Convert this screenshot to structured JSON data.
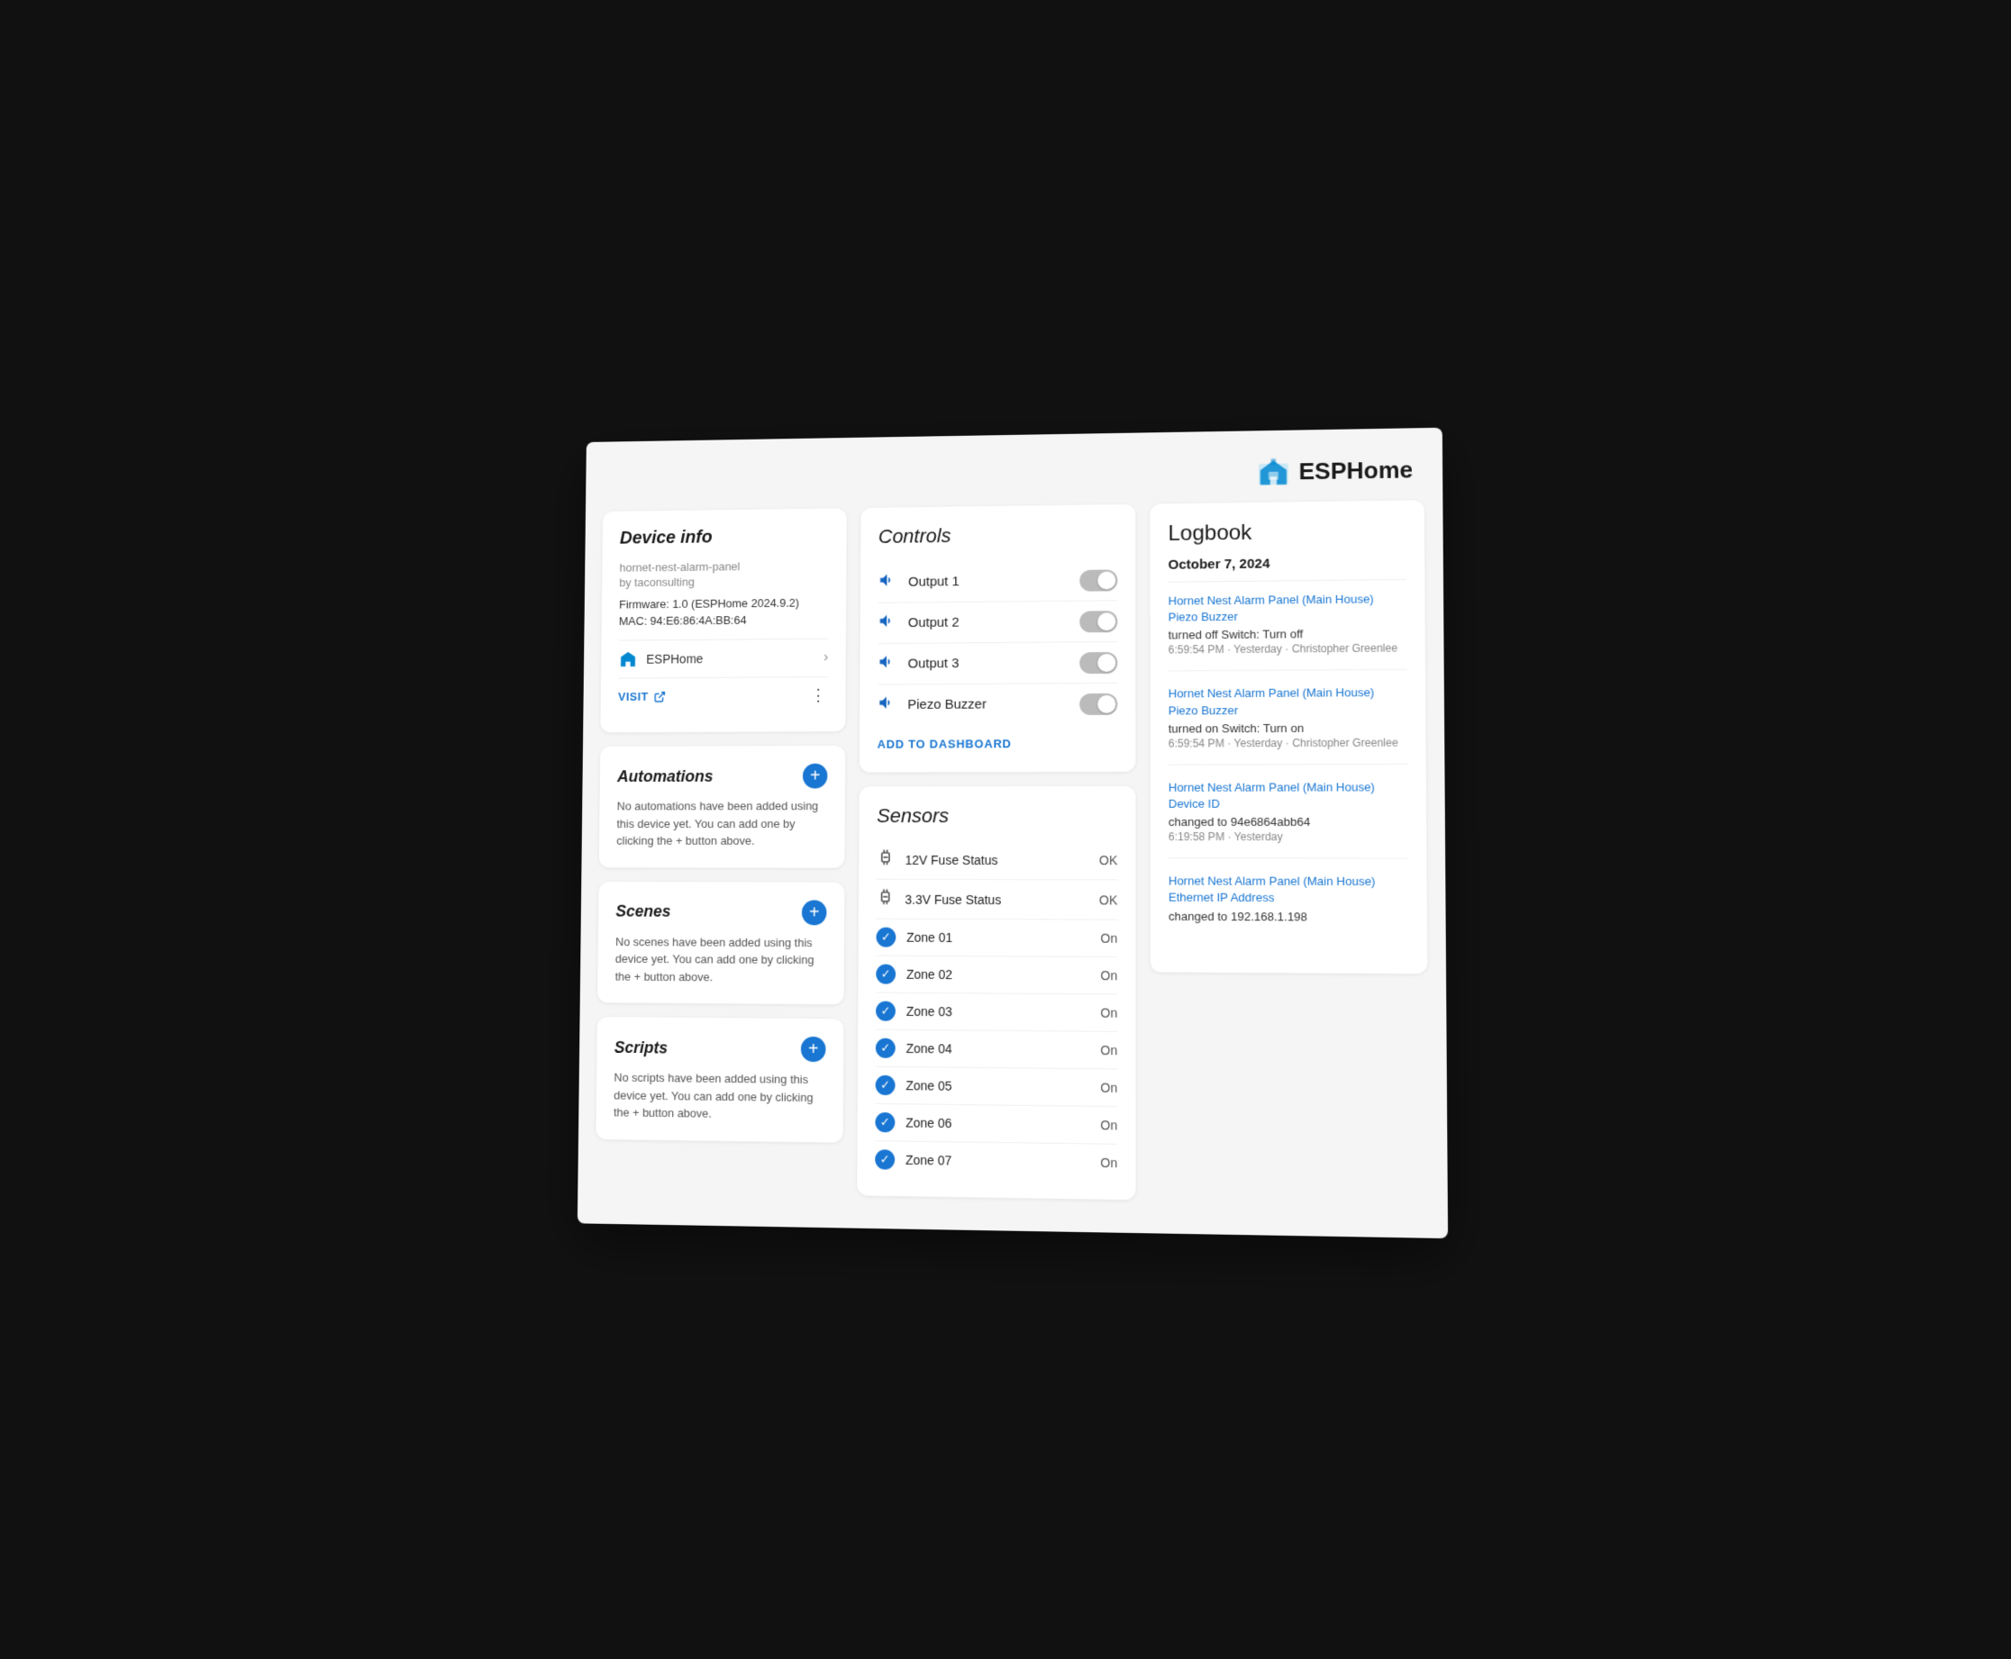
{
  "header": {
    "logo_text": "ESPHome"
  },
  "device_info": {
    "title": "Device info",
    "name": "hornet-nest-alarm-panel",
    "by": "by taconsulting",
    "firmware": "Firmware: 1.0 (ESPHome 2024.9.2)",
    "mac": "MAC: 94:E6:86:4A:BB:64",
    "esphome_link": "ESPHome",
    "visit_label": "VISIT",
    "chevron": "›",
    "more": "⋮"
  },
  "automations": {
    "title": "Automations",
    "empty_text": "No automations have been added using this device yet. You can add one by clicking the + button above.",
    "add_label": "+"
  },
  "scenes": {
    "title": "Scenes",
    "empty_text": "No scenes have been added using this device yet. You can add one by clicking the + button above.",
    "add_label": "+"
  },
  "scripts": {
    "title": "Scripts",
    "empty_text": "No scripts have been added using this device yet. You can add one by clicking the + button above.",
    "add_label": "+"
  },
  "controls": {
    "title": "Controls",
    "outputs": [
      {
        "label": "Output 1"
      },
      {
        "label": "Output 2"
      },
      {
        "label": "Output 3"
      },
      {
        "label": "Piezo Buzzer"
      }
    ],
    "add_to_dashboard": "ADD TO DASHBOARD"
  },
  "sensors": {
    "title": "Sensors",
    "items": [
      {
        "label": "12V Fuse Status",
        "value": "OK",
        "type": "fuse"
      },
      {
        "label": "3.3V Fuse Status",
        "value": "OK",
        "type": "fuse"
      },
      {
        "label": "Zone 01",
        "value": "On",
        "type": "check"
      },
      {
        "label": "Zone 02",
        "value": "On",
        "type": "check"
      },
      {
        "label": "Zone 03",
        "value": "On",
        "type": "check"
      },
      {
        "label": "Zone 04",
        "value": "On",
        "type": "check"
      },
      {
        "label": "Zone 05",
        "value": "On",
        "type": "check"
      },
      {
        "label": "Zone 06",
        "value": "On",
        "type": "check"
      },
      {
        "label": "Zone 07",
        "value": "On",
        "type": "check"
      }
    ]
  },
  "logbook": {
    "title": "Logbook",
    "period": "October 2024",
    "date_header": "October 7, 2024",
    "entries": [
      {
        "link_text": "Hornet Nest Alarm Panel (Main House) Piezo Buzzer",
        "action": "turned off Switch: Turn off",
        "time": "6:59:54 PM · Yesterday · Christopher Greenlee"
      },
      {
        "link_text": "Hornet Nest Alarm Panel (Main House) Piezo Buzzer",
        "action": "turned on Switch: Turn on",
        "time": "6:59:54 PM · Yesterday · Christopher Greenlee"
      },
      {
        "link_text": "Hornet Nest Alarm Panel (Main House) Device ID",
        "action": "changed to 94e6864abb64",
        "time": "6:19:58 PM · Yesterday"
      },
      {
        "link_text": "Hornet Nest Alarm Panel (Main House) Ethernet IP Address",
        "action": "changed to 192.168.1.198",
        "time": ""
      }
    ]
  }
}
